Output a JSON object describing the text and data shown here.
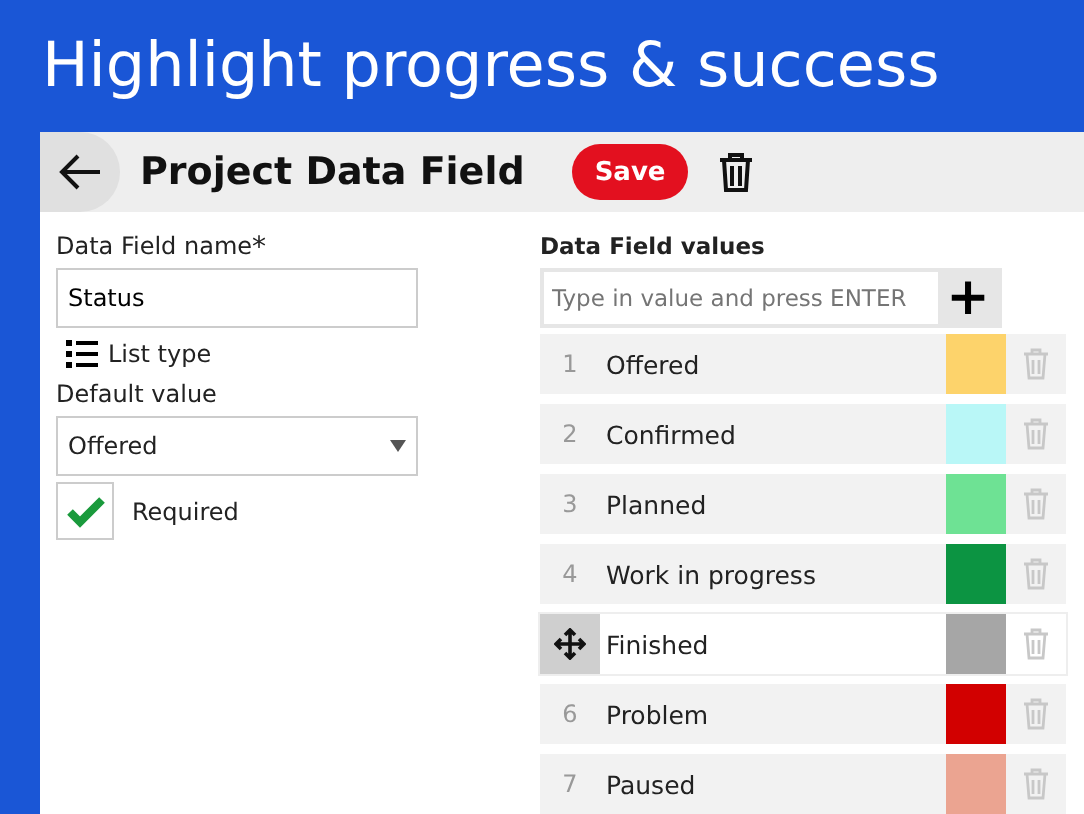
{
  "banner": {
    "title": "Highlight progress & success"
  },
  "header": {
    "title": "Project Data Field",
    "save_label": "Save"
  },
  "name_field": {
    "label": "Data Field name",
    "required_mark": "*",
    "value": "Status"
  },
  "type_label": "List type",
  "default_field": {
    "label": "Default value",
    "value": "Offered"
  },
  "required_checkbox": {
    "label": "Required",
    "checked": true
  },
  "values_panel": {
    "label": "Data Field values",
    "placeholder": "Type in value and press ENTER",
    "add_label": "+"
  },
  "values": [
    {
      "number": "1",
      "label": "Offered",
      "color": "#fdd36b",
      "hovered": false
    },
    {
      "number": "2",
      "label": "Confirmed",
      "color": "#b9f7f7",
      "hovered": false
    },
    {
      "number": "3",
      "label": "Planned",
      "color": "#6ee294",
      "hovered": false
    },
    {
      "number": "4",
      "label": "Work in progress",
      "color": "#0c9442",
      "hovered": false
    },
    {
      "label": "Finished",
      "color": "#a6a6a6",
      "hovered": true
    },
    {
      "number": "6",
      "label": "Problem",
      "color": "#d20000",
      "hovered": false
    },
    {
      "number": "7",
      "label": "Paused",
      "color": "#eba491",
      "hovered": false
    }
  ]
}
